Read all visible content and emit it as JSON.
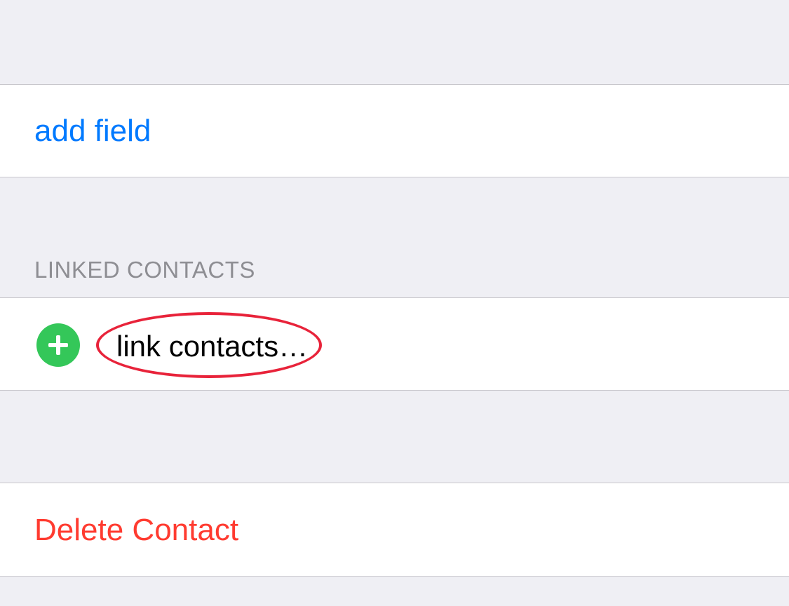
{
  "add_field": {
    "label": "add field"
  },
  "linked_contacts": {
    "header": "LINKED CONTACTS",
    "link_label": "link contacts…",
    "icon": "plus-circle-icon"
  },
  "delete": {
    "label": "Delete Contact"
  },
  "colors": {
    "background": "#efeff4",
    "row_background": "#ffffff",
    "separator": "#c8c7cc",
    "link_blue": "#007aff",
    "destructive_red": "#ff3b30",
    "add_green": "#34c759",
    "header_gray": "#8e8e93",
    "annotation_red": "#e8233a"
  }
}
